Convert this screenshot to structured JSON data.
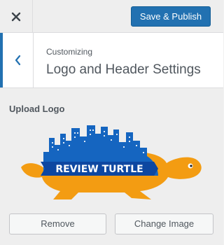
{
  "header": {
    "close_icon": "close-icon",
    "publish_label": "Save & Publish"
  },
  "section": {
    "back_icon": "chevron-left-icon",
    "breadcrumb": "Customizing",
    "title": "Logo and Header Settings"
  },
  "logo_control": {
    "label": "Upload Logo",
    "logo_text": "REVIEW TURTLE",
    "remove_label": "Remove",
    "change_label": "Change Image"
  },
  "colors": {
    "accent": "#2271b1",
    "logo_blue": "#1565c0",
    "logo_orange": "#f39c12"
  }
}
